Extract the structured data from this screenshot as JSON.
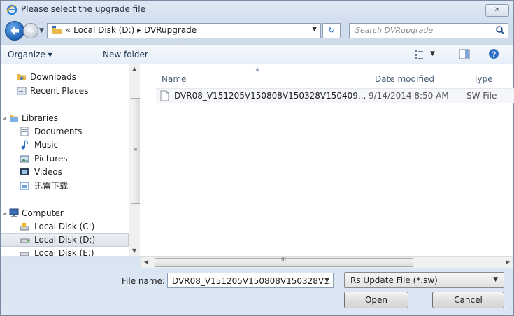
{
  "window": {
    "title": "Please select the upgrade file",
    "close_label": "✕"
  },
  "navbar": {
    "breadcrumb_prefix": "«",
    "breadcrumb": [
      "Local Disk (D:)",
      "DVRupgrade"
    ],
    "breadcrumb_sep": "▸",
    "search_placeholder": "Search DVRupgrade"
  },
  "toolbar": {
    "organize_label": "Organize ▾",
    "new_folder_label": "New folder"
  },
  "nav_pane": {
    "items": [
      {
        "label": "Downloads",
        "icon": "downloads-folder-icon"
      },
      {
        "label": "Recent Places",
        "icon": "recent-places-icon"
      },
      {
        "label": "Libraries",
        "icon": "libraries-icon"
      },
      {
        "label": "Documents",
        "icon": "documents-icon"
      },
      {
        "label": "Music",
        "icon": "music-icon"
      },
      {
        "label": "Pictures",
        "icon": "pictures-icon"
      },
      {
        "label": "Videos",
        "icon": "videos-icon"
      },
      {
        "label": "迅雷下载",
        "icon": "download-folder-icon"
      },
      {
        "label": "Computer",
        "icon": "computer-icon"
      },
      {
        "label": "Local Disk (C:)",
        "icon": "disk-c-icon"
      },
      {
        "label": "Local Disk (D:)",
        "icon": "disk-d-icon",
        "selected": true
      },
      {
        "label": "Local Disk (E:)",
        "icon": "disk-e-icon"
      }
    ]
  },
  "file_list": {
    "columns": [
      "Name",
      "Date modified",
      "Type"
    ],
    "rows": [
      {
        "name": "DVR08_V151205V150808V150328V150409...",
        "date": "9/14/2014 8:50 AM",
        "type": "SW File"
      }
    ]
  },
  "scrollbar": {
    "grip": "≡",
    "hgrip": "III"
  },
  "footer": {
    "file_name_label": "File name:",
    "file_name_value": "DVR08_V151205V150808V150328V1",
    "filter_value": "Rs Update File (*.sw)",
    "open_label": "Open",
    "cancel_label": "Cancel"
  },
  "colors": {
    "accent": "#2b6bd1",
    "selection": "#dde3ea"
  }
}
